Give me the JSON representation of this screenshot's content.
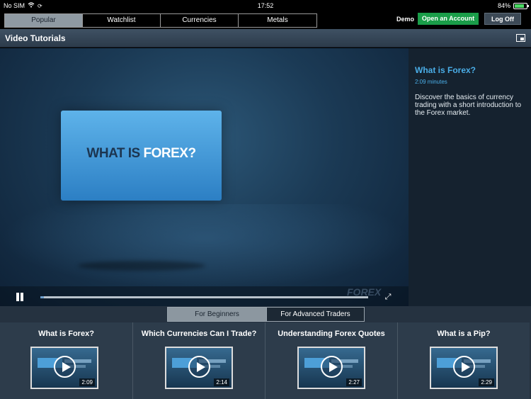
{
  "status": {
    "carrier": "No SIM",
    "time": "17:52",
    "battery": "84%",
    "battery_level": 0.84
  },
  "nav": {
    "tabs": [
      "Popular",
      "Watchlist",
      "Currencies",
      "Metals"
    ],
    "active_tab": "Popular",
    "demo": "Demo",
    "open_account": "Open an Account",
    "log_off": "Log Off"
  },
  "page": {
    "title": "Video Tutorials"
  },
  "player": {
    "card_text_part1": "WHAT IS ",
    "card_text_part2": "FOREX?",
    "watermark": "FOREX",
    "progress": 0.01
  },
  "details": {
    "title": "What is Forex?",
    "duration": "2:09 minutes",
    "description": "Discover the basics of currency trading with a short introduction to the Forex market."
  },
  "lower_tabs": {
    "beginners": "For Beginners",
    "advanced": "For Advanced Traders"
  },
  "videos": [
    {
      "title": "What is Forex?",
      "duration": "2:09"
    },
    {
      "title": "Which Currencies Can I Trade?",
      "duration": "2:14"
    },
    {
      "title": "Understanding Forex Quotes",
      "duration": "2:27"
    },
    {
      "title": "What is a Pip?",
      "duration": "2:29"
    }
  ],
  "colors": {
    "accent": "#4aaee8",
    "green": "#1a9d49"
  }
}
